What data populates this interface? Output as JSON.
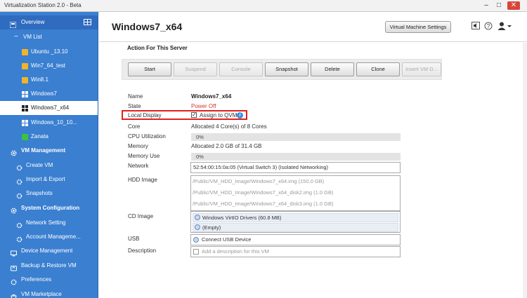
{
  "window": {
    "title": "Virtualization Station 2.0 - Beta"
  },
  "sidebar": {
    "overview": "Overview",
    "vm_list": "VM List",
    "vms": [
      {
        "label": "Ubuntu _13.10",
        "color": "#f0b429"
      },
      {
        "label": "Win7_64_test",
        "color": "#f0b429"
      },
      {
        "label": "Win8.1",
        "color": "#f0b429"
      },
      {
        "label": "Windows7",
        "color": "#ffffff"
      },
      {
        "label": "Windows7_x64",
        "color": "#222222"
      },
      {
        "label": "Windows_10_10...",
        "color": "#ffffff"
      },
      {
        "label": "Zanata",
        "color": "#3cc23c"
      }
    ],
    "vm_management": "VM Management",
    "vm_management_items": [
      "Create VM",
      "Import & Export",
      "Snapshots"
    ],
    "system_configuration": "System Configuration",
    "system_configuration_items": [
      "Network Setting",
      "Account Manageme..."
    ],
    "device_management": "Device Management",
    "backup_restore": "Backup & Restore VM",
    "preferences": "Preferences",
    "vm_marketplace": "VM Marketplace"
  },
  "header": {
    "title": "Windows7_x64",
    "vm_settings_label": "Virtual Machine Settings"
  },
  "actions": {
    "title": "Action For This Server",
    "buttons": [
      {
        "label": "Start",
        "enabled": true
      },
      {
        "label": "Suspend",
        "enabled": false
      },
      {
        "label": "Console",
        "enabled": false
      },
      {
        "label": "Snapshot",
        "enabled": true
      },
      {
        "label": "Delete",
        "enabled": true
      },
      {
        "label": "Clone",
        "enabled": true
      },
      {
        "label": "Insert VM D...",
        "enabled": false
      }
    ]
  },
  "properties": {
    "name_label": "Name",
    "name_value": "Windows7_x64",
    "state_label": "State",
    "state_value": "Power Off",
    "local_display_label": "Local Display",
    "assign_label": "Assign to QVM",
    "assign_checked": true,
    "core_label": "Core",
    "core_value": "Allocated 4 Core(s) of 8 Cores",
    "cpu_label": "CPU Utilization",
    "cpu_value": "0%",
    "cpu_fraction": 0,
    "memory_label": "Memory",
    "memory_value": "Allocated 2.0 GB of 31.4 GB",
    "memory_use_label": "Memory Use",
    "memory_use_value": "0%",
    "memory_use_fraction": 0,
    "network_label": "Network",
    "network_value": "52:54:00:15:0a:05 (Virtual Switch 3) (Isolated Networking)",
    "hdd_label": "HDD Image",
    "hdd_images": [
      "/Public/VM_HDD_Image/Windows7_x64.img (150.0 GB)",
      "/Public/VM_HDD_Image/Windows7_x64_disk2.img (1.0 GB)",
      "/Public/VM_HDD_Image/Windows7_x64_disk3.img (1.0 GB)"
    ],
    "cd_label": "CD Image",
    "cd_images": [
      "Windows VirtIO Drivers (60.8 MB)",
      "(Empty)"
    ],
    "usb_label": "USB",
    "usb_value": "Connect USB Device",
    "description_label": "Description",
    "description_placeholder": "Add a description for this VM"
  },
  "colors": {
    "sidebar_bg": "#3a7fd0",
    "state_red": "#d03a2c",
    "highlight": "#e02020"
  }
}
